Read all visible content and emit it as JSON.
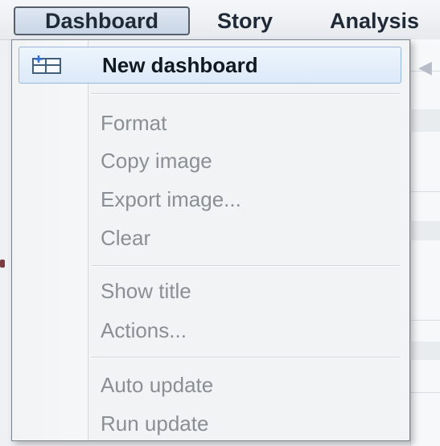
{
  "menubar": {
    "items": [
      {
        "label": "Dashboard",
        "active": true
      },
      {
        "label": "Story"
      },
      {
        "label": "Analysis"
      }
    ]
  },
  "dropdown": {
    "items": [
      {
        "label": "New dashboard",
        "enabled": true,
        "icon": "new-dashboard-icon"
      },
      {
        "label": "Format",
        "enabled": false
      },
      {
        "label": "Copy image",
        "enabled": false
      },
      {
        "label": "Export image...",
        "enabled": false
      },
      {
        "label": "Clear",
        "enabled": false
      },
      {
        "label": "Show title",
        "enabled": false
      },
      {
        "label": "Actions...",
        "enabled": false
      },
      {
        "label": "Auto update",
        "enabled": false
      },
      {
        "label": "Run update",
        "enabled": false
      }
    ]
  },
  "colors": {
    "highlight_border": "#98b8da",
    "highlight_fill": "#dce9f8",
    "disabled_text": "#8a8f96",
    "enabled_text": "#101820"
  }
}
